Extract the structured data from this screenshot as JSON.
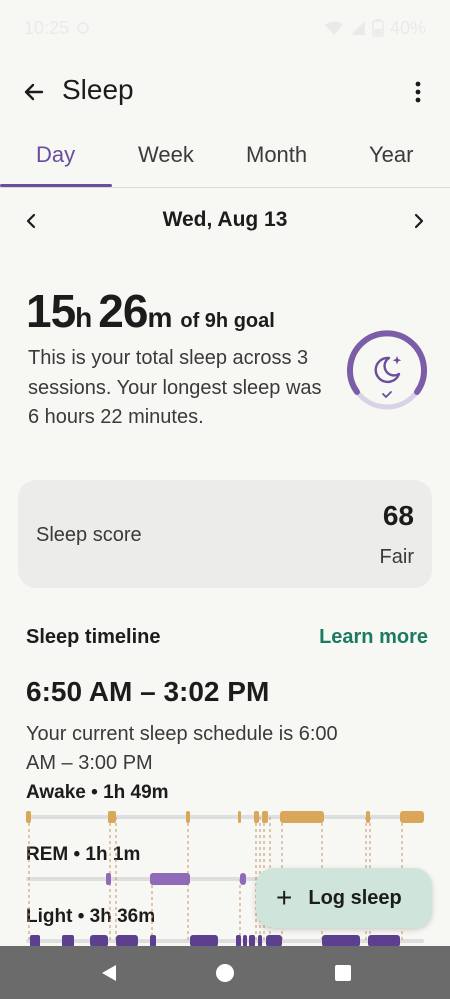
{
  "status_bar": {
    "time": "10:25",
    "battery": "40%"
  },
  "app_bar": {
    "title": "Sleep",
    "back_icon": "arrow-back-icon",
    "more_icon": "more-vert-icon"
  },
  "tabs": [
    {
      "label": "Day",
      "active": true
    },
    {
      "label": "Week",
      "active": false
    },
    {
      "label": "Month",
      "active": false
    },
    {
      "label": "Year",
      "active": false
    }
  ],
  "date_nav": {
    "label": "Wed, Aug 13"
  },
  "total": {
    "hours": "15",
    "hours_unit": "h",
    "minutes": "26",
    "minutes_unit": "m",
    "goal_text": "of 9h goal",
    "summary": "This is your total sleep across 3 sessions. Your longest sleep was 6 hours 22 minutes.",
    "ring_icon": "moon-stars-icon",
    "ring_color": "#7b5ea7"
  },
  "sleep_score": {
    "label": "Sleep score",
    "value": "68",
    "status": "Fair"
  },
  "timeline": {
    "title": "Sleep timeline",
    "learn_more": "Learn more",
    "range": "6:50 AM – 3:02 PM",
    "schedule": "Your current sleep schedule is 6:00 AM – 3:00 PM",
    "stages": [
      {
        "name": "Awake",
        "label": "Awake • 1h 49m",
        "color": "#d9a65a"
      },
      {
        "name": "REM",
        "label": "REM • 1h 1m",
        "color": "#8e6ab8"
      },
      {
        "name": "Light",
        "label": "Light • 3h 36m",
        "color": "#5c3f8f"
      }
    ]
  },
  "fab": {
    "label": "Log sleep",
    "icon": "plus-icon"
  },
  "nav": {
    "back_icon": "nav-back-icon",
    "home_icon": "nav-home-icon",
    "recents_icon": "nav-recents-icon"
  },
  "colors": {
    "accent": "#6a4e9c",
    "link": "#1b7a61",
    "fab_bg": "#cfe5dc"
  }
}
